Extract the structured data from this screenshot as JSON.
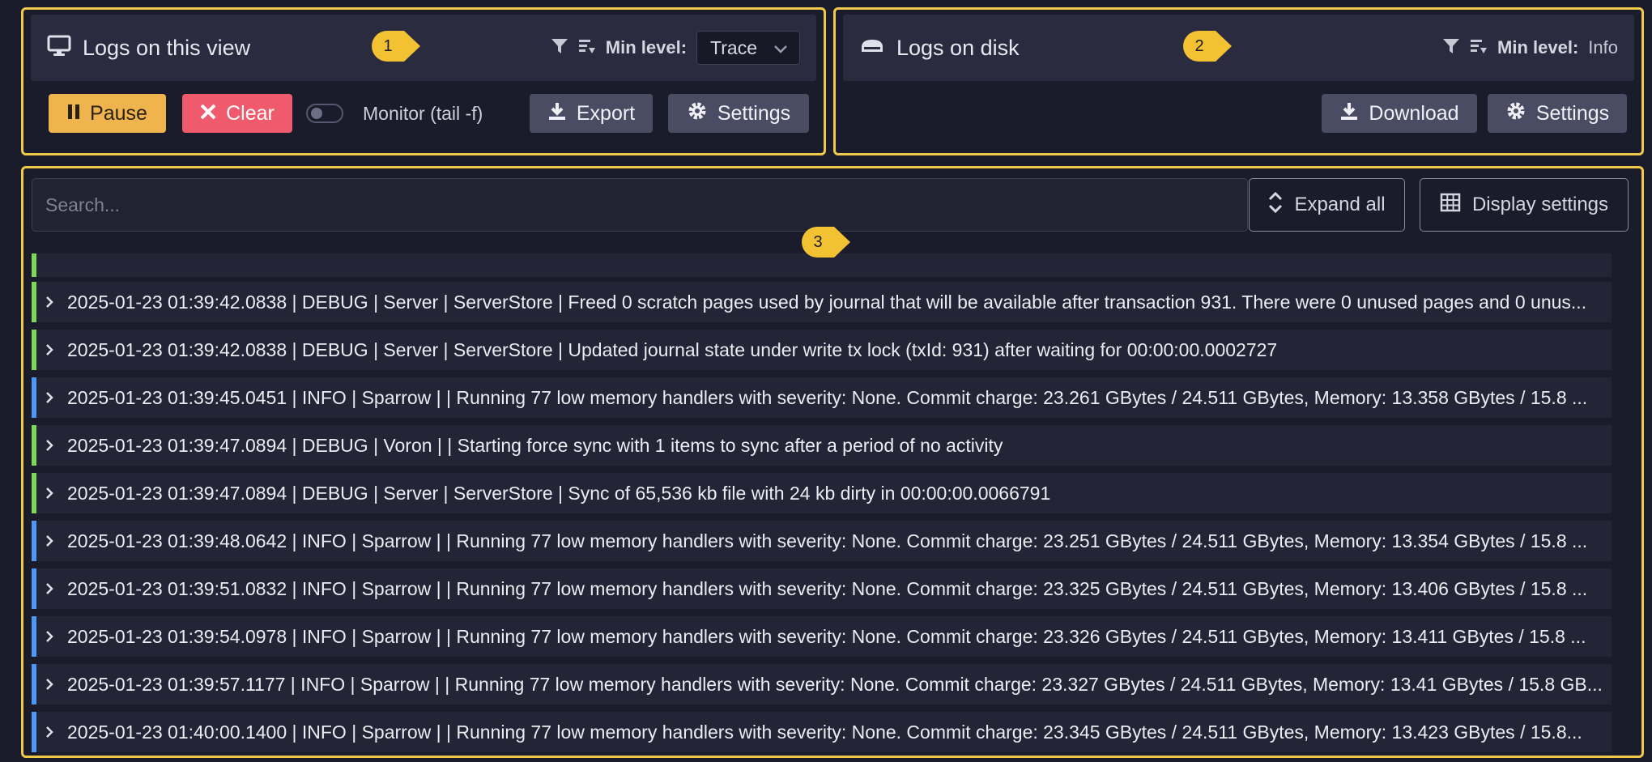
{
  "colors": {
    "accent_frame": "#f0c94a",
    "debug_bar": "#7ed957",
    "info_bar": "#4e97f5",
    "pause_button": "#efb44d",
    "clear_button": "#ef5b6c"
  },
  "view_panel": {
    "title": "Logs on this view",
    "icon": "monitor-icon",
    "min_level_label": "Min level:",
    "min_level_value": "Trace",
    "pause_label": "Pause",
    "clear_label": "Clear",
    "monitor_label": "Monitor (tail -f)",
    "export_label": "Export",
    "settings_label": "Settings"
  },
  "disk_panel": {
    "title": "Logs on disk",
    "icon": "disk-icon",
    "min_level_label": "Min level:",
    "min_level_value": "Info",
    "download_label": "Download",
    "settings_label": "Settings"
  },
  "logs_panel": {
    "search_placeholder": "Search...",
    "expand_all_label": "Expand all",
    "display_settings_label": "Display settings"
  },
  "badges": [
    "1",
    "2",
    "3"
  ],
  "logs": [
    {
      "level": "DEBUG",
      "text": "2025-01-23 01:39:42.0838 | DEBUG | Server | ServerStore | Freed 0 scratch pages used by journal that will be available after transaction 931. There were 0 unused pages and 0 unus..."
    },
    {
      "level": "DEBUG",
      "text": "2025-01-23 01:39:42.0838 | DEBUG | Server | ServerStore | Updated journal state under write tx lock (txId: 931) after waiting for 00:00:00.0002727"
    },
    {
      "level": "INFO",
      "text": "2025-01-23 01:39:45.0451 | INFO | Sparrow | | Running 77 low memory handlers with severity: None. Commit charge: 23.261 GBytes / 24.511 GBytes, Memory: 13.358 GBytes / 15.8 ..."
    },
    {
      "level": "DEBUG",
      "text": "2025-01-23 01:39:47.0894 | DEBUG | Voron | | Starting force sync with 1 items to sync after a period of no activity"
    },
    {
      "level": "DEBUG",
      "text": "2025-01-23 01:39:47.0894 | DEBUG | Server | ServerStore | Sync of 65,536 kb file with 24 kb dirty in 00:00:00.0066791"
    },
    {
      "level": "INFO",
      "text": "2025-01-23 01:39:48.0642 | INFO | Sparrow | | Running 77 low memory handlers with severity: None. Commit charge: 23.251 GBytes / 24.511 GBytes, Memory: 13.354 GBytes / 15.8 ..."
    },
    {
      "level": "INFO",
      "text": "2025-01-23 01:39:51.0832 | INFO | Sparrow | | Running 77 low memory handlers with severity: None. Commit charge: 23.325 GBytes / 24.511 GBytes, Memory: 13.406 GBytes / 15.8 ..."
    },
    {
      "level": "INFO",
      "text": "2025-01-23 01:39:54.0978 | INFO | Sparrow | | Running 77 low memory handlers with severity: None. Commit charge: 23.326 GBytes / 24.511 GBytes, Memory: 13.411 GBytes / 15.8 ..."
    },
    {
      "level": "INFO",
      "text": "2025-01-23 01:39:57.1177 | INFO | Sparrow | | Running 77 low memory handlers with severity: None. Commit charge: 23.327 GBytes / 24.511 GBytes, Memory: 13.41 GBytes / 15.8 GB..."
    },
    {
      "level": "INFO",
      "text": "2025-01-23 01:40:00.1400 | INFO | Sparrow | | Running 77 low memory handlers with severity: None. Commit charge: 23.345 GBytes / 24.511 GBytes, Memory: 13.423 GBytes / 15.8..."
    }
  ]
}
